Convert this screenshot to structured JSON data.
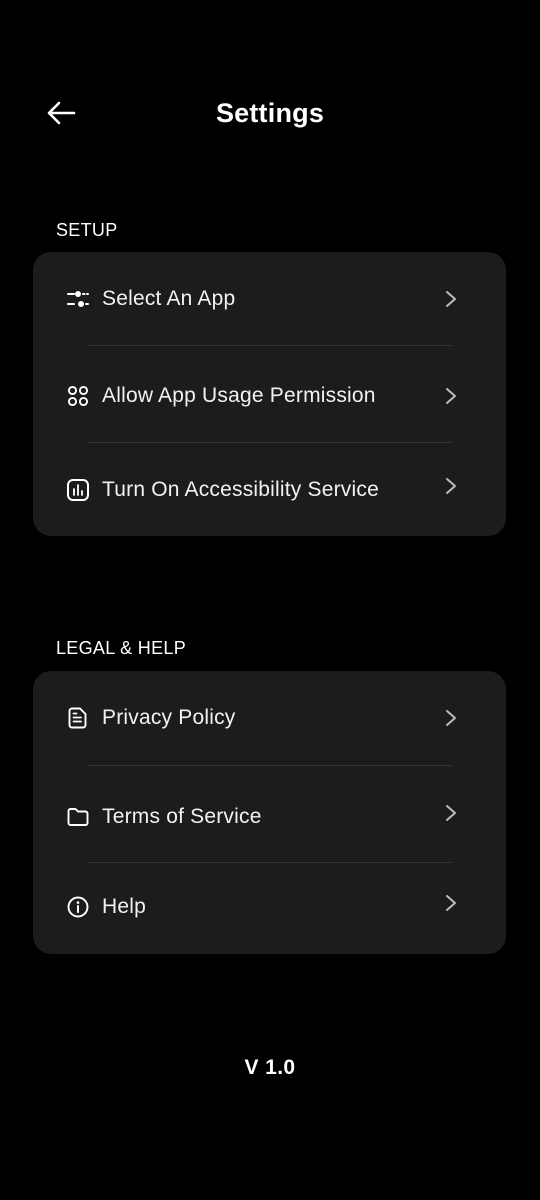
{
  "header": {
    "title": "Settings",
    "back_icon": "arrow-left-icon"
  },
  "sections": [
    {
      "title": "SETUP",
      "items": [
        {
          "label": "Select An App",
          "icon": "sliders-icon"
        },
        {
          "label": "Allow App Usage Permission",
          "icon": "grid-dots-icon"
        },
        {
          "label": "Turn On Accessibility Service",
          "icon": "bar-chart-icon"
        }
      ]
    },
    {
      "title": "LEGAL & HELP",
      "items": [
        {
          "label": "Privacy Policy",
          "icon": "document-icon"
        },
        {
          "label": "Terms of Service",
          "icon": "folder-icon"
        },
        {
          "label": "Help",
          "icon": "info-icon"
        }
      ]
    }
  ],
  "footer": {
    "version": "V 1.0"
  },
  "colors": {
    "background": "#000000",
    "card": "#1c1c1c",
    "divider": "#363636",
    "text": "#ffffff"
  }
}
